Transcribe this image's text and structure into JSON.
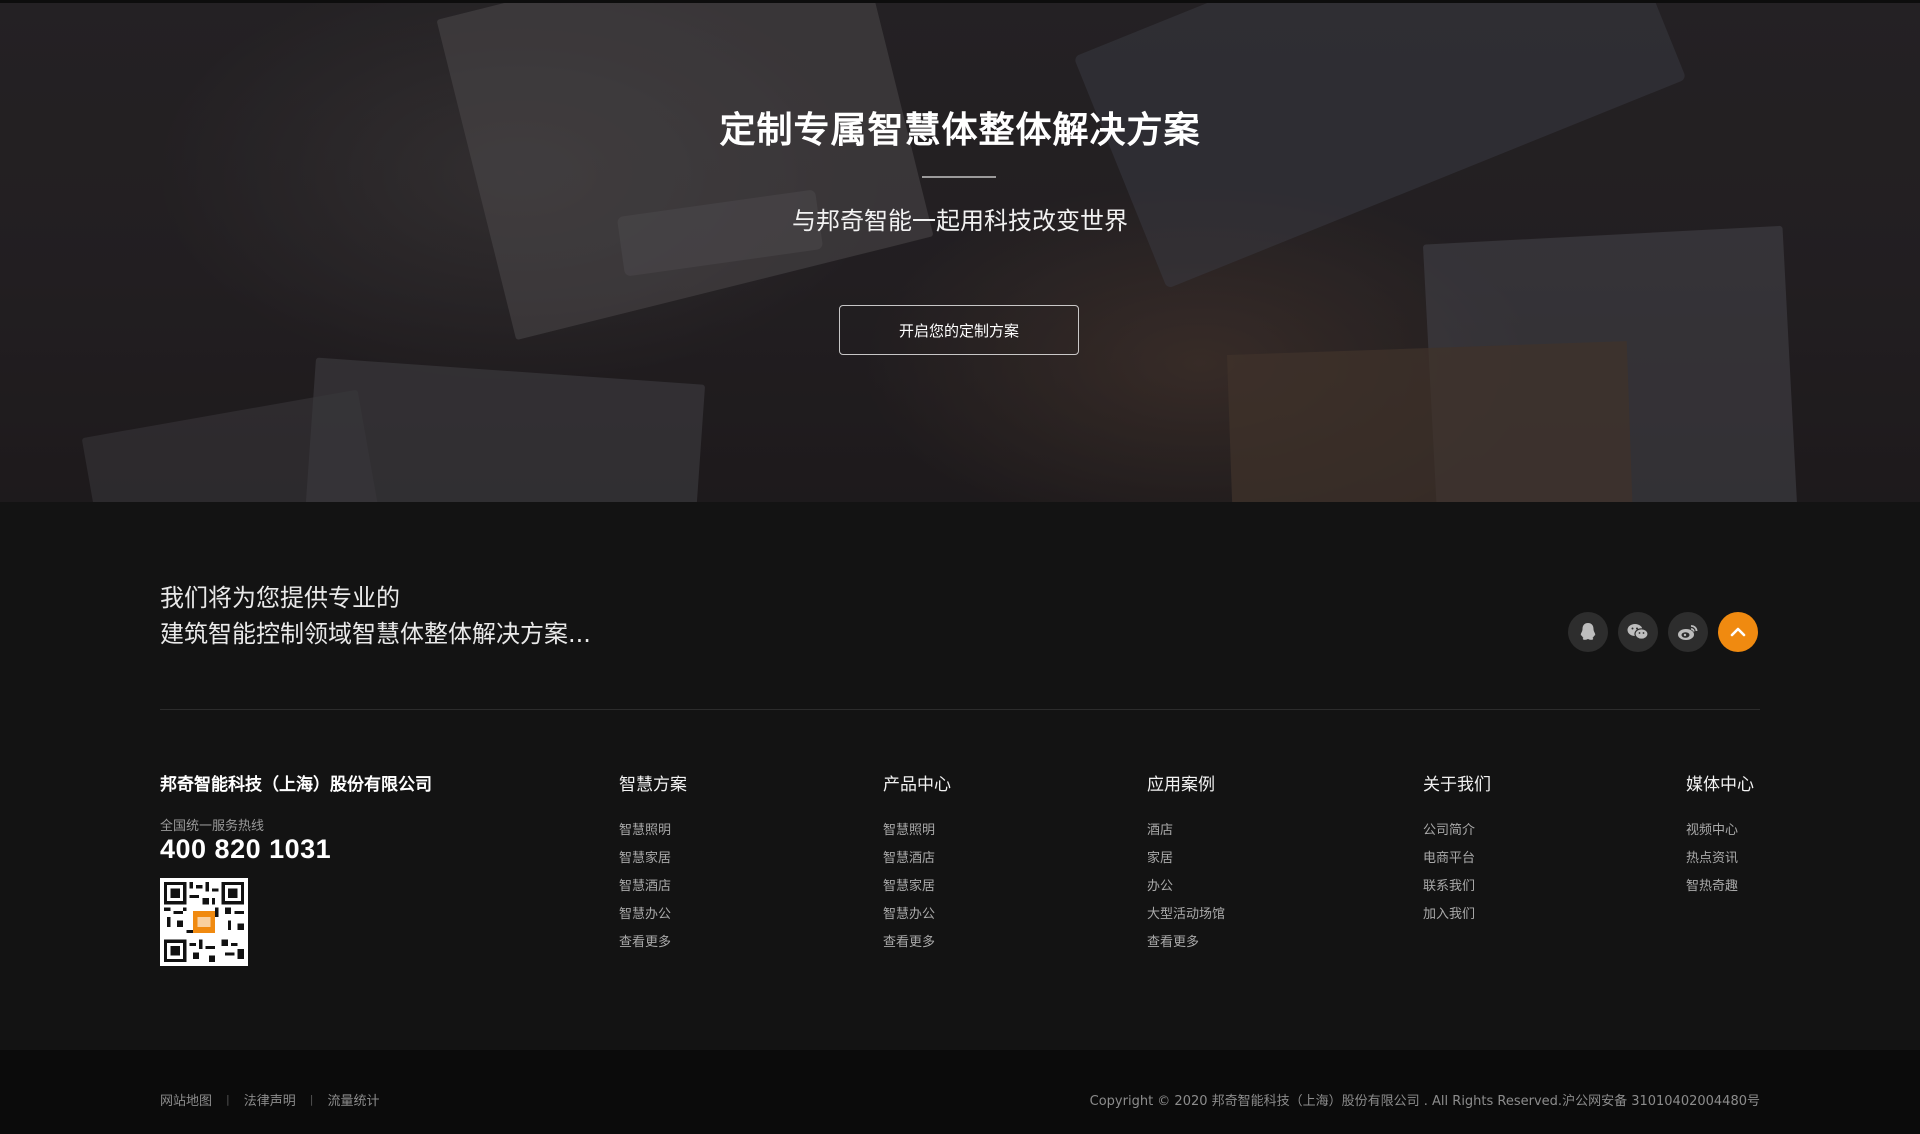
{
  "hero": {
    "title": "定制专属智慧体整体解决方案",
    "subtitle": "与邦奇智能一起用科技改变世界",
    "button_label": "开启您的定制方案"
  },
  "footer": {
    "slogan_line1": "我们将为您提供专业的",
    "slogan_line2": "建筑智能控制领域智慧体整体解决方案...",
    "social_icons": [
      "qq-icon",
      "wechat-icon",
      "weibo-icon",
      "back-to-top-icon"
    ],
    "accent_color": "#f08a10",
    "company_name": "邦奇智能科技（上海）股份有限公司",
    "hotline_label": "全国统一服务热线",
    "hotline": "400 820 1031",
    "columns": [
      {
        "title": "智慧方案",
        "links": [
          "智慧照明",
          "智慧家居",
          "智慧酒店",
          "智慧办公",
          "查看更多"
        ]
      },
      {
        "title": "产品中心",
        "links": [
          "智慧照明",
          "智慧酒店",
          "智慧家居",
          "智慧办公",
          "查看更多"
        ]
      },
      {
        "title": "应用案例",
        "links": [
          "酒店",
          "家居",
          "办公",
          "大型活动场馆",
          "查看更多"
        ]
      },
      {
        "title": "关于我们",
        "links": [
          "公司简介",
          "电商平台",
          "联系我们",
          "加入我们"
        ]
      },
      {
        "title": "媒体中心",
        "links": [
          "视频中心",
          "热点资讯",
          "智热奇趣"
        ]
      }
    ]
  },
  "bottom": {
    "links": [
      "网站地图",
      "法律声明",
      "流量统计"
    ],
    "separator": "|",
    "copyright": "Copyright © 2020 邦奇智能科技（上海）股份有限公司 . All Rights Reserved.沪公网安备 31010402004480号"
  }
}
